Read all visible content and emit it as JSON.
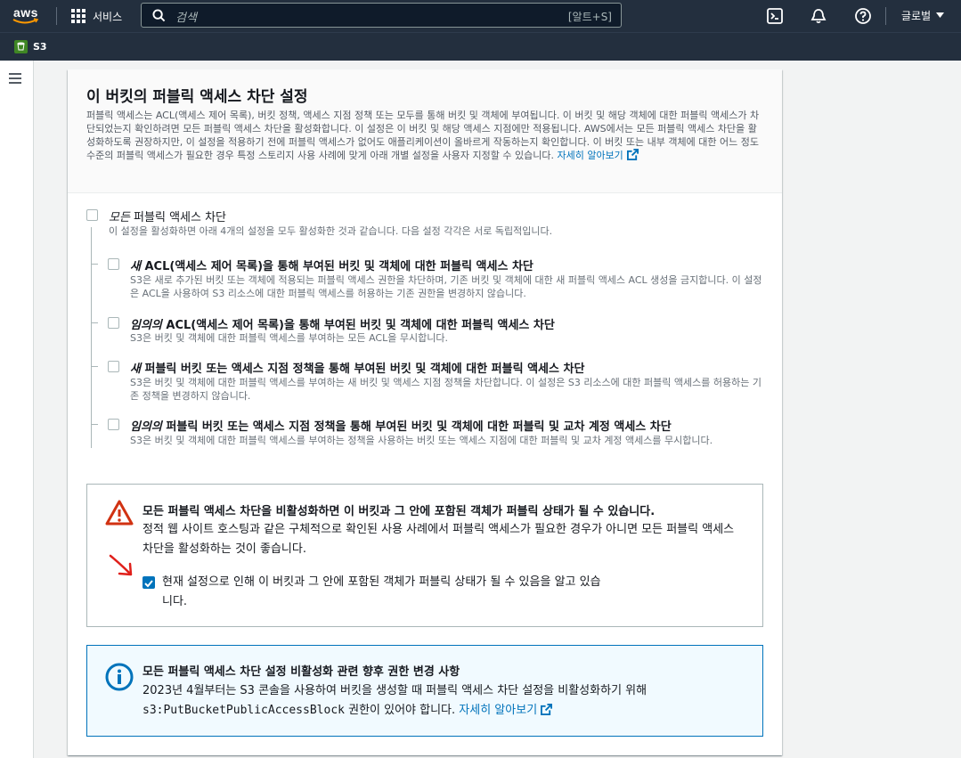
{
  "topnav": {
    "logo": "aws",
    "services_label": "서비스",
    "search_placeholder": "검색",
    "search_shortcut": "[알트+S]",
    "region_label": "글로벌",
    "icons": [
      "grid-icon",
      "search-icon",
      "cloudshell-icon",
      "bell-icon",
      "help-icon",
      "caret-down-icon"
    ]
  },
  "favorites": {
    "s3_label": "S3"
  },
  "panel": {
    "title": "이 버킷의 퍼블릭 액세스 차단 설정",
    "description": "퍼블릭 액세스는 ACL(액세스 제어 목록), 버킷 정책, 액세스 지점 정책 또는 모두를 통해 버킷 및 객체에 부여됩니다. 이 버킷 및 해당 객체에 대한 퍼블릭 액세스가 차단되었는지 확인하려면 모든 퍼블릭 액세스 차단을 활성화합니다. 이 설정은 이 버킷 및 해당 액세스 지점에만 적용됩니다. AWS에서는 모든 퍼블릭 액세스 차단을 활성화하도록 권장하지만, 이 설정을 적용하기 전에 퍼블릭 액세스가 없어도 애플리케이션이 올바르게 작동하는지 확인합니다. 이 버킷 또는 내부 객체에 대한 어느 정도 수준의 퍼블릭 액세스가 필요한 경우 특정 스토리지 사용 사례에 맞게 아래 개별 설정을 사용자 지정할 수 있습니다.",
    "learn_more": "자세히 알아보기"
  },
  "block_all": {
    "title_em": "모든",
    "title_rest": " 퍼블릭 액세스 차단",
    "desc": "이 설정을 활성화하면 아래 4개의 설정을 모두 활성화한 것과 같습니다. 다음 설정 각각은 서로 독립적입니다.",
    "checked": false
  },
  "options": [
    {
      "title_em": "새",
      "title_rest": " ACL(액세스 제어 목록)을 통해 부여된 버킷 및 객체에 대한 퍼블릭 액세스 차단",
      "desc": "S3은 새로 추가된 버킷 또는 객체에 적용되는 퍼블릭 액세스 권한을 차단하며, 기존 버킷 및 객체에 대한 새 퍼블릭 액세스 ACL 생성을 금지합니다. 이 설정은 ACL을 사용하여 S3 리소스에 대한 퍼블릭 액세스를 허용하는 기존 권한을 변경하지 않습니다.",
      "checked": false
    },
    {
      "title_em": "임의의",
      "title_rest": " ACL(액세스 제어 목록)을 통해 부여된 버킷 및 객체에 대한 퍼블릭 액세스 차단",
      "desc": "S3은 버킷 및 객체에 대한 퍼블릭 액세스를 부여하는 모든 ACL을 무시합니다.",
      "checked": false
    },
    {
      "title_em": "새",
      "title_rest": " 퍼블릭 버킷 또는 액세스 지점 정책을 통해 부여된 버킷 및 객체에 대한 퍼블릭 액세스 차단",
      "desc": "S3은 버킷 및 객체에 대한 퍼블릭 액세스를 부여하는 새 버킷 및 액세스 지점 정책을 차단합니다. 이 설정은 S3 리소스에 대한 퍼블릭 액세스를 허용하는 기존 정책을 변경하지 않습니다.",
      "checked": false
    },
    {
      "title_em": "임의의",
      "title_rest": " 퍼블릭 버킷 또는 액세스 지점 정책을 통해 부여된 버킷 및 객체에 대한 퍼블릭 및 교차 계정 액세스 차단",
      "desc": "S3은 버킷 및 객체에 대한 퍼블릭 액세스를 부여하는 정책을 사용하는 버킷 또는 액세스 지점에 대한 퍼블릭 및 교차 계정 액세스를 무시합니다.",
      "checked": false
    }
  ],
  "warning": {
    "title": "모든 퍼블릭 액세스 차단을 비활성화하면 이 버킷과 그 안에 포함된 객체가 퍼블릭 상태가 될 수 있습니다.",
    "text": "정적 웹 사이트 호스팅과 같은 구체적으로 확인된 사용 사례에서 퍼블릭 액세스가 필요한 경우가 아니면 모든 퍼블릭 액세스 차단을 활성화하는 것이 좋습니다.",
    "ack": "현재 설정으로 인해 이 버킷과 그 안에 포함된 객체가 퍼블릭 상태가 될 수 있음을 알고 있습니다.",
    "ack_checked": true
  },
  "info": {
    "title": "모든 퍼블릭 액세스 차단 설정 비활성화 관련 향후 권한 변경 사항",
    "text_line1": "2023년 4월부터는 S3 콘솔을 사용하여 버킷을 생성할 때 퍼블릭 액세스 차단 설정을 비활성화하기 위해",
    "permission": "s3:PutBucketPublicAccessBlock",
    "text_line2": " 권한이 있어야 합니다.",
    "learn_more": "자세히 알아보기"
  },
  "colors": {
    "nav_bg": "#232f3e",
    "link": "#0073bb",
    "warning_red": "#d13212",
    "info_blue": "#0073bb",
    "annotation_arrow": "#e0201b"
  }
}
